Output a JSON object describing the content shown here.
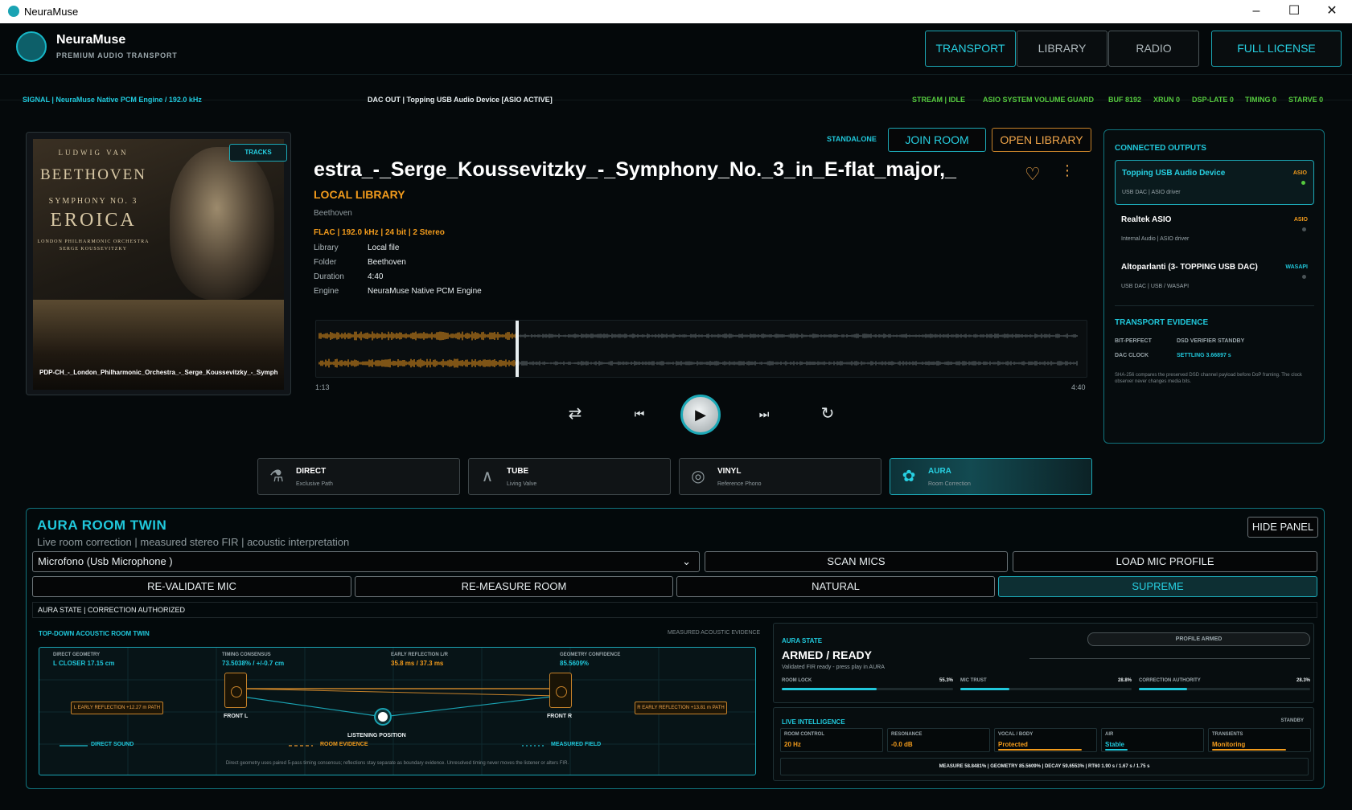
{
  "window": {
    "title": "NeuraMuse"
  },
  "brand": {
    "name": "NeuraMuse",
    "subtitle": "PREMIUM AUDIO TRANSPORT"
  },
  "nav": {
    "transport": "TRANSPORT",
    "library": "LIBRARY",
    "radio": "RADIO",
    "license": "FULL LICENSE"
  },
  "status": {
    "signal": "SIGNAL  |  NeuraMuse Native PCM Engine / 192.0 kHz",
    "dac": "DAC OUT  |  Topping USB Audio Device  [ASIO ACTIVE]",
    "stream": "STREAM  |  IDLE",
    "guard": "ASIO SYSTEM VOLUME GUARD",
    "buf": "BUF 8192",
    "xrun": "XRUN 0",
    "dsplate": "DSP-LATE 0",
    "timing": "TIMING 0",
    "starve": "STARVE 0"
  },
  "cover": {
    "tracks_tag": "TRACKS",
    "line1": "LUDWIG VAN",
    "line2": "BEETHOVEN",
    "line3": "SYMPHONY NO. 3",
    "line4": "EROICA",
    "line5": "LONDON PHILHARMONIC ORCHESTRA",
    "line6": "SERGE KOUSSEVITZKY",
    "caption": "PDP-CH_-_London_Philharmonic_Orchestra_-_Serge_Koussevitzky_-_Symphony_N..."
  },
  "track": {
    "standalone": "STANDALONE",
    "join": "JOIN ROOM",
    "open_library": "OPEN LIBRARY",
    "title": "estra_-_Serge_Koussevitzky_-_Symphony_No._3_in_E-flat_major,_",
    "source": "LOCAL LIBRARY",
    "artist": "Beethoven",
    "format": "FLAC  |  192.0 kHz  |  24 bit  |  2 Stereo",
    "meta": [
      {
        "k": "Library",
        "v": "Local file"
      },
      {
        "k": "Folder",
        "v": "Beethoven"
      },
      {
        "k": "Duration",
        "v": "4:40"
      },
      {
        "k": "Engine",
        "v": "NeuraMuse Native PCM Engine"
      }
    ],
    "elapsed": "1:13",
    "total": "4:40",
    "progress": 0.26
  },
  "outputs": {
    "title": "CONNECTED OUTPUTS",
    "items": [
      {
        "name": "Topping USB Audio Device",
        "sub": "USB DAC  |  ASIO driver",
        "tag": "ASIO"
      },
      {
        "name": "Realtek ASIO",
        "sub": "Internal Audio  |  ASIO driver",
        "tag": "ASIO"
      },
      {
        "name": "Altoparlanti (3- TOPPING USB DAC)",
        "sub": "USB DAC  |  USB / WASAPI",
        "tag": "WASAPI"
      }
    ],
    "evidence_title": "TRANSPORT EVIDENCE",
    "bit_k": "BIT-PERFECT",
    "bit_v": "DSD VERIFIER STANDBY",
    "clock_k": "DAC CLOCK",
    "clock_v": "SETTLING 3.66897 s",
    "note": "SHA-256 compares the preserved DSD channel payload before DoP framing. The clock observer never changes media bits."
  },
  "modes": [
    {
      "name": "DIRECT",
      "sub": "Exclusive Path"
    },
    {
      "name": "TUBE",
      "sub": "Living Valve"
    },
    {
      "name": "VINYL",
      "sub": "Reference Phono"
    },
    {
      "name": "AURA",
      "sub": "Room Correction"
    }
  ],
  "aura": {
    "title": "AURA ROOM TWIN",
    "subtitle": "Live room correction | measured stereo FIR | acoustic interpretation",
    "hide": "HIDE PANEL",
    "mic": "Microfono (Usb  Microphone        )",
    "scan": "SCAN MICS",
    "load": "LOAD MIC PROFILE",
    "revalidate": "RE-VALIDATE MIC",
    "remeasure": "RE-MEASURE ROOM",
    "natural": "NATURAL",
    "supreme": "SUPREME",
    "state_line": "AURA STATE  |  CORRECTION AUTHORIZED",
    "twin_title": "TOP-DOWN ACOUSTIC ROOM TWIN",
    "measured": "MEASURED ACOUSTIC EVIDENCE",
    "metrics": [
      {
        "k": "DIRECT GEOMETRY",
        "v": "L CLOSER  17.15 cm"
      },
      {
        "k": "TIMING CONSENSUS",
        "v": "73.5038% / +/-0.7 cm"
      },
      {
        "k": "EARLY REFLECTION L/R",
        "v": "35.8 ms / 37.3 ms"
      },
      {
        "k": "GEOMETRY CONFIDENCE",
        "v": "85.5609%"
      }
    ],
    "front_l": "FRONT L",
    "front_r": "FRONT R",
    "listen": "LISTENING POSITION",
    "refl_l": "L EARLY REFLECTION  +12.27 m PATH",
    "refl_r": "R EARLY REFLECTION  +13.81 m PATH",
    "leg_direct": "DIRECT SOUND",
    "leg_room": "ROOM EVIDENCE",
    "leg_field": "MEASURED FIELD",
    "footnote": "Direct geometry uses paired 5-pass timing consensus; reflections stay separate as boundary evidence. Unresolved timing never moves the listener or alters FIR.",
    "state_label": "AURA STATE",
    "profile": "PROFILE ARMED",
    "armed": "ARMED / READY",
    "validated": "Validated FIR ready - press play in AURA",
    "bars": [
      {
        "k": "ROOM LOCK",
        "v": "55.3%",
        "f": 0.553
      },
      {
        "k": "MIC TRUST",
        "v": "28.8%",
        "f": 0.288
      },
      {
        "k": "CORRECTION AUTHORITY",
        "v": "28.3%",
        "f": 0.283
      }
    ],
    "live_title": "LIVE INTELLIGENCE",
    "standby": "STANDBY",
    "cells": [
      {
        "k": "ROOM CONTROL",
        "v": "20 Hz",
        "c": "#f29b1c",
        "f": 0
      },
      {
        "k": "RESONANCE",
        "v": "-0.0 dB",
        "c": "#f29b1c",
        "f": 0
      },
      {
        "k": "VOCAL / BODY",
        "v": "Protected",
        "c": "#f29b1c",
        "f": 0.85
      },
      {
        "k": "AIR",
        "v": "Stable",
        "c": "#20c8db",
        "f": 0.3
      },
      {
        "k": "TRANSIENTS",
        "v": "Monitoring",
        "c": "#f29b1c",
        "f": 0.75
      }
    ],
    "summary": "MEASURE 58.8481%  |  GEOMETRY 85.5609%  |  DECAY 59.6553%  |  RT60  1.90 s  /  1.67 s  /  1.75 s"
  },
  "colors": {
    "accent": "#20c8db",
    "warm": "#f29b1c",
    "ok": "#55c93e"
  }
}
